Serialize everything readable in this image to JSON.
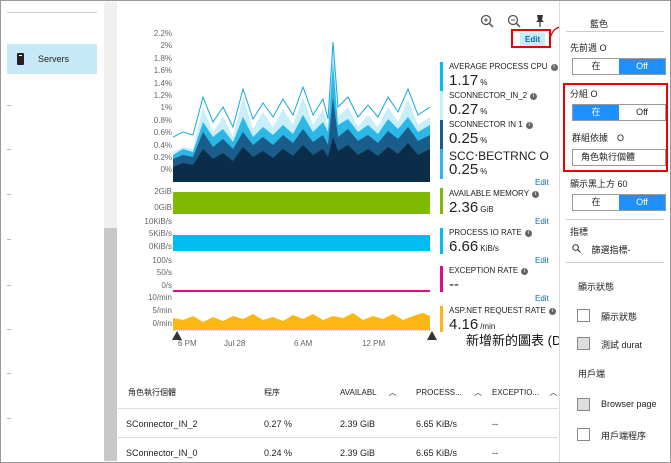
{
  "nav": {
    "servers_label": "Servers"
  },
  "toolbar": {
    "zoom_in": "⊕",
    "zoom_out": "⊖",
    "pin": "📌",
    "edit_chip": "Edit"
  },
  "charts": {
    "cpu_axis": [
      "2.2%",
      "2%",
      "1.8%",
      "1.6%",
      "1.4%",
      "1.2%",
      "1%",
      "0.8%",
      "0.6%",
      "0.4%",
      "0.2%",
      "0%"
    ],
    "memory_axis": [
      "2GiB",
      "0GiB"
    ],
    "io_axis": [
      "10KiB/s",
      "5KiB/s",
      "0KiB/s"
    ],
    "exception_axis": [
      "100/s",
      "50/s",
      "0/s"
    ],
    "request_axis": [
      "10/min",
      "5/min",
      "0/min"
    ],
    "x_labels": [
      "6 PM",
      "Jul 28",
      "6 AM",
      "12 PM"
    ],
    "edit_link": "Edit"
  },
  "metrics": {
    "cpu_avg": {
      "name": "AVERAGE PROCESS CPU",
      "value": "1.17",
      "unit": "%"
    },
    "connector2": {
      "name": "SCONNECTOR_IN_2",
      "value": "0.27",
      "unit": "%"
    },
    "connector1": {
      "name": "SCONNECTOR IN 1",
      "value": "0.25",
      "unit": "%"
    },
    "connector_c": {
      "name": "SCC‧BECTRNC O",
      "value": "0.25",
      "unit": "%"
    },
    "memory": {
      "name": "AVAILABLE MEMORY",
      "value": "2.36",
      "unit": "GiB"
    },
    "io": {
      "name": "PROCESS IO RATE",
      "value": "6.66",
      "unit": "KiB/s"
    },
    "exceptions": {
      "name": "EXCEPTION RATE",
      "value": "--",
      "unit": ""
    },
    "requests": {
      "name": "ASP.NET REQUEST RATE",
      "value": "4.16",
      "unit": "/min"
    }
  },
  "callout": "新增新的圖表 (D",
  "grid": {
    "headers": [
      "角色執行個體",
      "程序",
      "AVAILABL",
      "PROCESS...",
      "EXCEPTIO..."
    ],
    "rows": [
      [
        "SConnector_IN_2",
        "0.27 %",
        "2.39 GiB",
        "6.65 KiB/s",
        "--"
      ],
      [
        "SConnector_IN_0",
        "0.24 %",
        "2.39 GiB",
        "6.65 KiB/s",
        "--"
      ]
    ]
  },
  "panel": {
    "color_label": "藍色",
    "prev_week_label": "先前週 O",
    "prev_week_on": "在",
    "prev_week_off": "Off",
    "group_label": "分組 O",
    "group_on": "在",
    "group_off": "Off",
    "group_by_label": "群組依據　O",
    "group_by_value": "角色執行個體",
    "show_above_label": "顯示黑上方 60",
    "show_above_on": "在",
    "show_above_off": "Off",
    "metrics_label": "指標",
    "metrics_select": "篩選指標-",
    "show_status_header": "顯示狀態",
    "check1": "顯示狀態",
    "check2": "測試 durat",
    "section2": "用戶端",
    "check3": "Browser page",
    "check4": "用戶端程序"
  }
}
